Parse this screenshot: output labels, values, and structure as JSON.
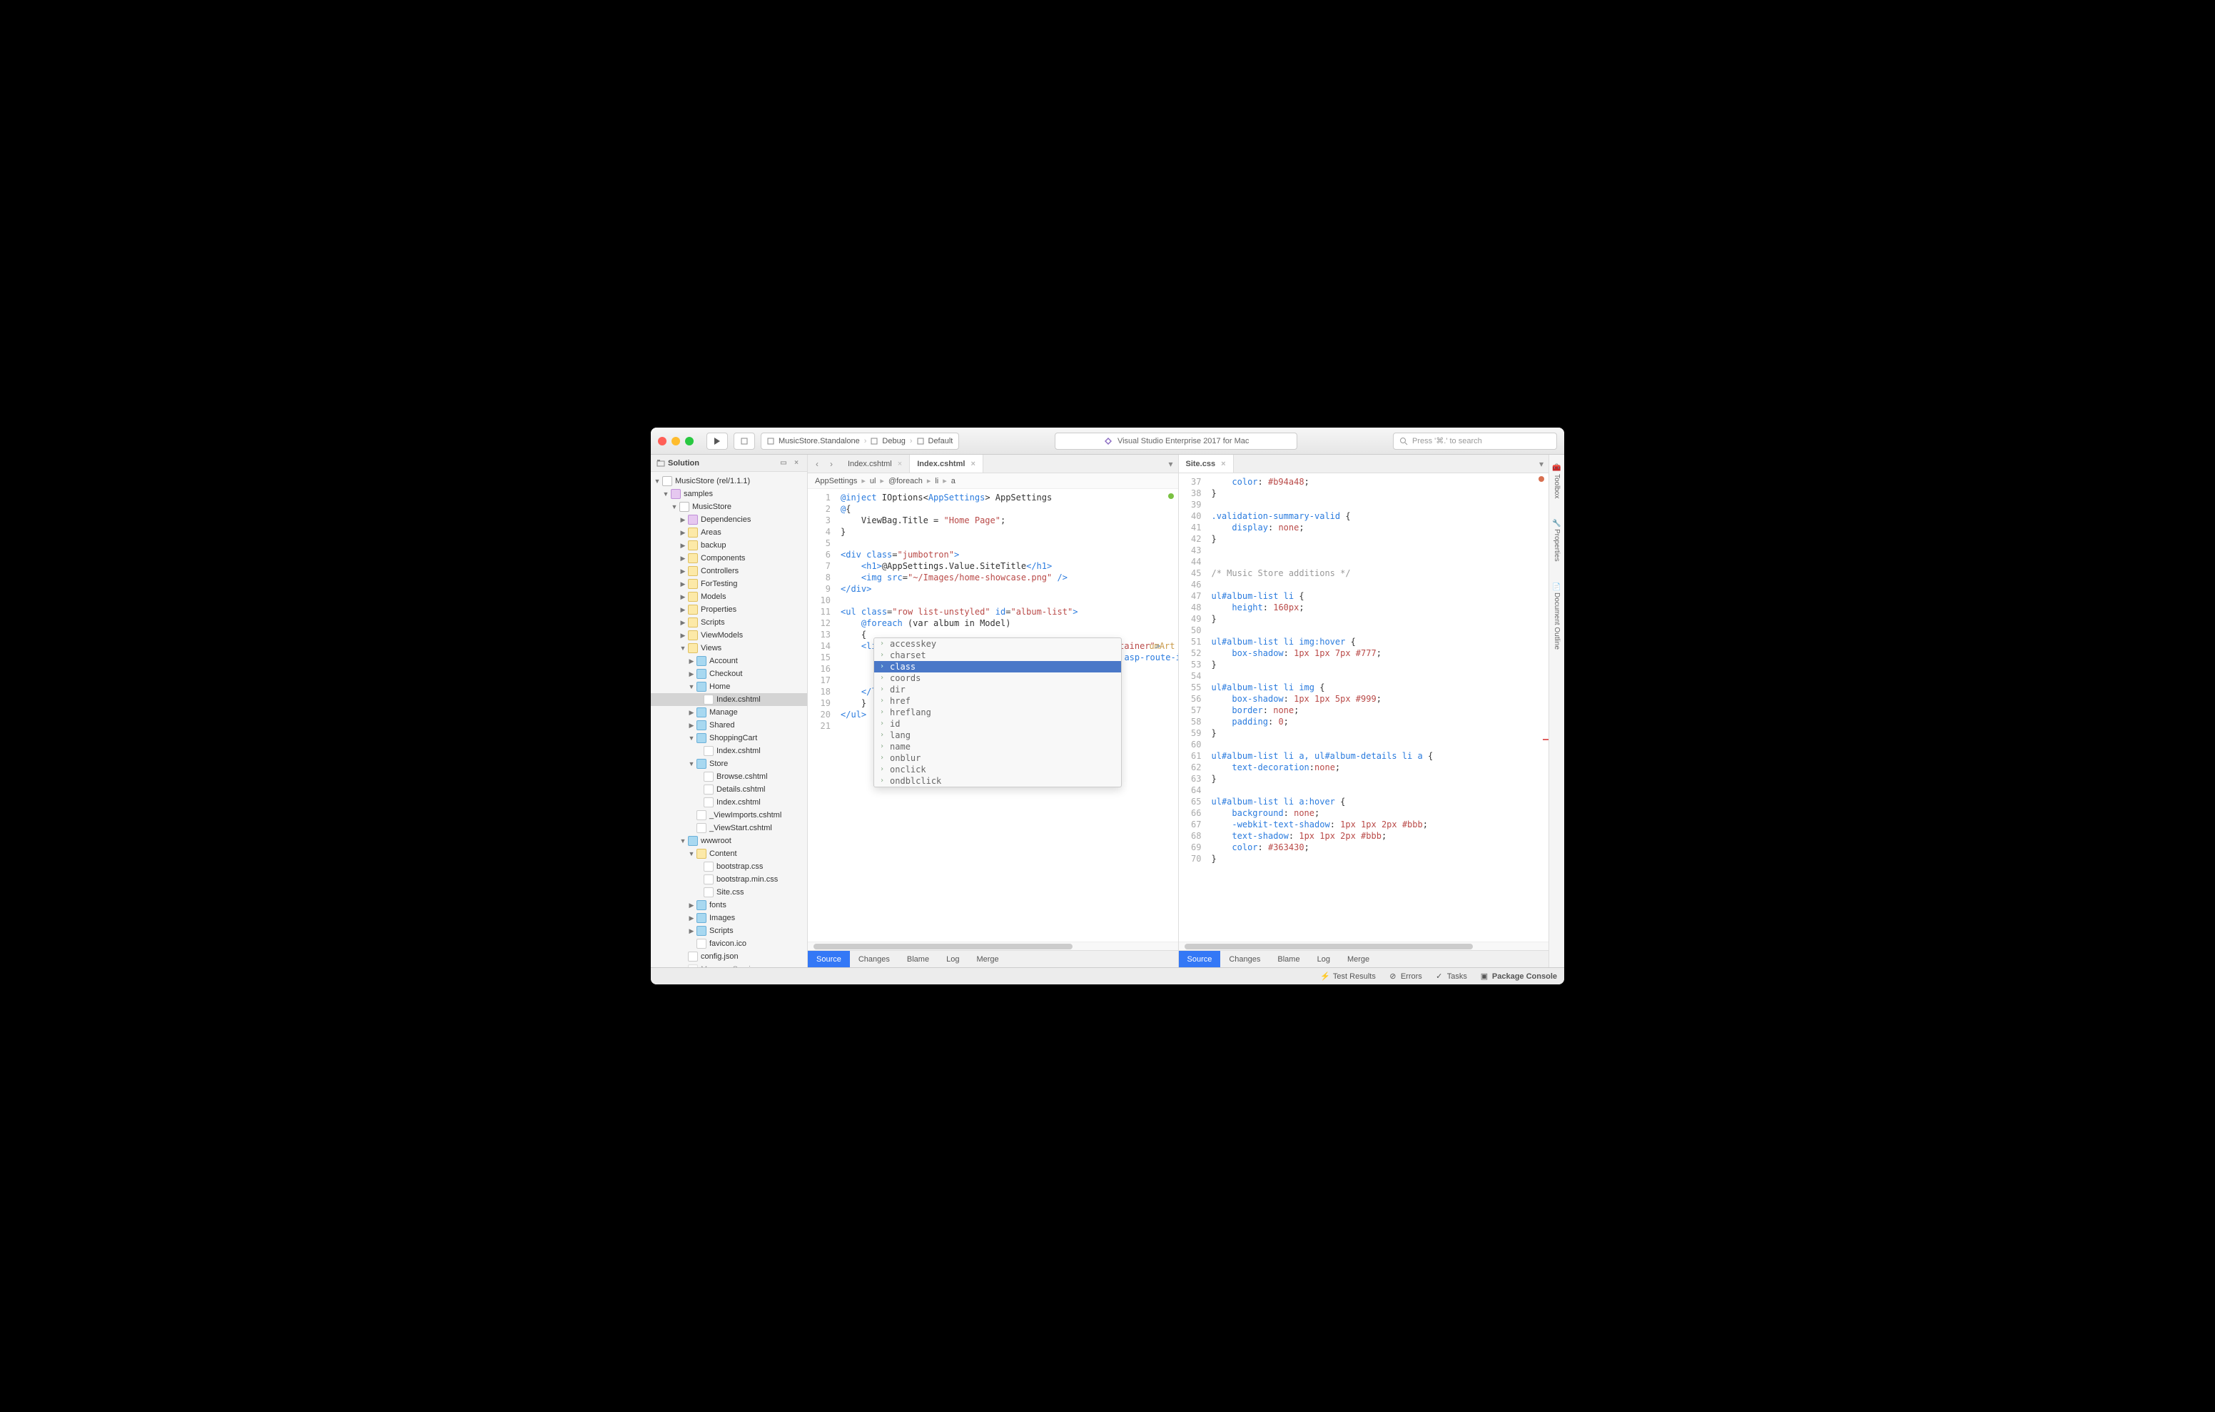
{
  "titlebar": {
    "project": "MusicStore.Standalone",
    "config": "Debug",
    "device": "Default",
    "title": "Visual Studio Enterprise 2017 for Mac",
    "search_placeholder": "Press '⌘.' to search"
  },
  "solution_pad": {
    "title": "Solution",
    "root": "MusicStore (rel/1.1.1)",
    "nodes": {
      "samples": "samples",
      "musicstore": "MusicStore",
      "dependencies": "Dependencies",
      "areas": "Areas",
      "backup": "backup",
      "components": "Components",
      "controllers": "Controllers",
      "fortesting": "ForTesting",
      "models": "Models",
      "properties": "Properties",
      "scripts": "Scripts",
      "viewmodels": "ViewModels",
      "views": "Views",
      "account": "Account",
      "checkout": "Checkout",
      "home": "Home",
      "index_cshtml": "Index.cshtml",
      "manage": "Manage",
      "shared": "Shared",
      "shoppingcart": "ShoppingCart",
      "sc_index": "Index.cshtml",
      "store": "Store",
      "browse": "Browse.cshtml",
      "details": "Details.cshtml",
      "st_index": "Index.cshtml",
      "viewimports": "_ViewImports.cshtml",
      "viewstart": "_ViewStart.cshtml",
      "wwwroot": "wwwroot",
      "content": "Content",
      "bootstrap": "bootstrap.css",
      "bootstrapmin": "bootstrap.min.css",
      "sitecss": "Site.css",
      "fonts": "fonts",
      "images": "Images",
      "wscripts": "Scripts",
      "favicon": "favicon.ico",
      "configjson": "config.json",
      "msgsvc": "MessageServices.cs"
    }
  },
  "left_editor": {
    "tabs": {
      "t1": "Index.cshtml",
      "t2": "Index.cshtml"
    },
    "breadcrumb": [
      "AppSettings",
      "ul",
      "@foreach",
      "li",
      "a"
    ],
    "line_start": 1,
    "line_end": 21,
    "overflow_hint": "umArt",
    "autocomplete": [
      "accesskey",
      "charset",
      "class",
      "coords",
      "dir",
      "href",
      "hreflang",
      "id",
      "lang",
      "name",
      "onblur",
      "onclick",
      "ondblclick"
    ],
    "autocomplete_selected": "class"
  },
  "right_editor": {
    "tabs": {
      "t1": "Site.css"
    },
    "line_start": 37,
    "line_end": 70
  },
  "bottom_tabs": [
    "Source",
    "Changes",
    "Blame",
    "Log",
    "Merge"
  ],
  "right_pads": [
    "Toolbox",
    "Properties",
    "Document Outline"
  ],
  "statusbar": {
    "tests": "Test Results",
    "errors": "Errors",
    "tasks": "Tasks",
    "pkg": "Package Console"
  }
}
